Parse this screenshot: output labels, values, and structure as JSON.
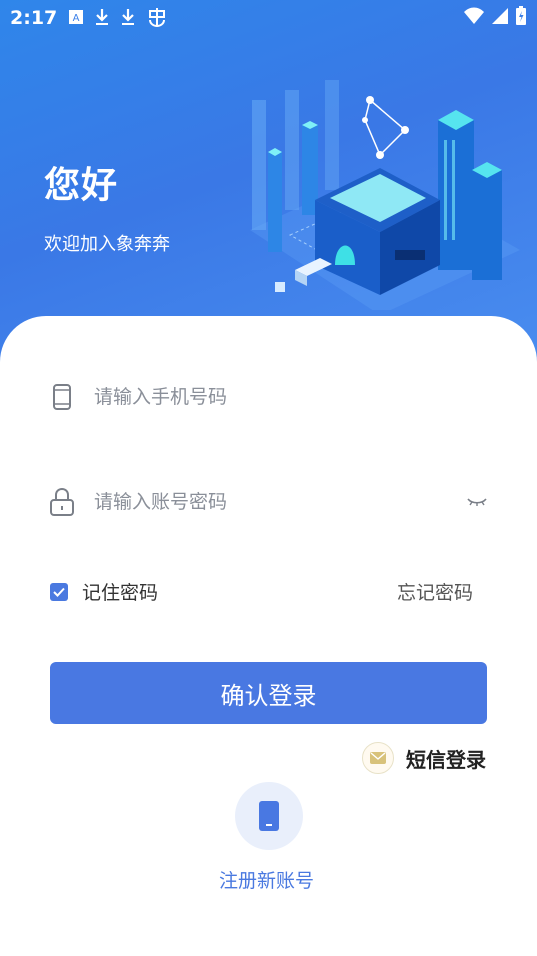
{
  "status_bar": {
    "time": "2:17"
  },
  "hero": {
    "greeting": "您好",
    "welcome": "欢迎加入象奔奔"
  },
  "form": {
    "phone_placeholder": "请输入手机号码",
    "password_placeholder": "请输入账号密码",
    "remember_label": "记住密码",
    "remember_checked": true,
    "forgot_label": "忘记密码",
    "login_label": "确认登录",
    "sms_login_label": "短信登录",
    "register_label": "注册新账号"
  },
  "icons": {
    "phone": "phone-icon",
    "lock": "lock-icon",
    "eye": "eye-closed-icon",
    "check": "check-icon",
    "mail": "mail-icon",
    "mobile": "mobile-icon"
  },
  "colors": {
    "primary": "#4978e2",
    "hero_start": "#2f86ea",
    "hero_end": "#4a8ef0"
  }
}
